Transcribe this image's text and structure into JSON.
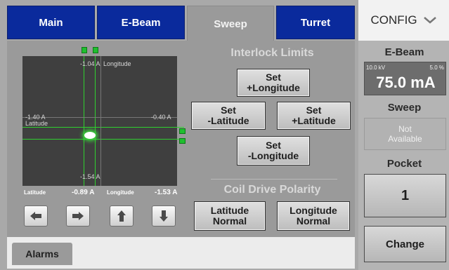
{
  "tabs": [
    {
      "label": "Main"
    },
    {
      "label": "E-Beam"
    },
    {
      "label": "Sweep"
    },
    {
      "label": "Turret"
    }
  ],
  "config": {
    "label": "CONFIG",
    "icon": "chevron-down-icon"
  },
  "plot": {
    "top_value": "-1.04 A",
    "top_label": "Longitude",
    "left_value": "-1.40 A",
    "left_label": "Latitude",
    "right_value": "-0.40 A",
    "bottom_value": "-1.54 A",
    "beam_color": "#ffffff",
    "grid_color": "#2fd02f"
  },
  "readouts": {
    "latitude_label": "Latitude",
    "latitude_value": "-0.89 A",
    "longitude_label": "Longitude",
    "longitude_value": "-1.53 A"
  },
  "arrows": [
    "left-arrow-icon",
    "right-arrow-icon",
    "up-arrow-icon",
    "down-arrow-icon"
  ],
  "interlock": {
    "title": "Interlock Limits",
    "set_plus_longitude": [
      "Set",
      "+Longitude"
    ],
    "set_minus_latitude": [
      "Set",
      "-Latitude"
    ],
    "set_plus_latitude": [
      "Set",
      "+Latitude"
    ],
    "set_minus_longitude": [
      "Set",
      "-Longitude"
    ]
  },
  "polarity": {
    "title": "Coil Drive Polarity",
    "latitude": [
      "Latitude",
      "Normal"
    ],
    "longitude": [
      "Longitude",
      "Normal"
    ]
  },
  "bottom": {
    "alarms_label": "Alarms"
  },
  "side": {
    "ebeam_title": "E-Beam",
    "kv": "10.0 kV",
    "pct": "5.0 %",
    "ma": "75.0 mA",
    "sweep_title": "Sweep",
    "sweep_status": [
      "Not",
      "Available"
    ],
    "pocket_title": "Pocket",
    "pocket_value": "1",
    "change_label": "Change"
  },
  "colors": {
    "tab_blue": "#0a2a9c",
    "panel_gray": "#9a9a9a",
    "marker_green": "#1fbf2f"
  }
}
